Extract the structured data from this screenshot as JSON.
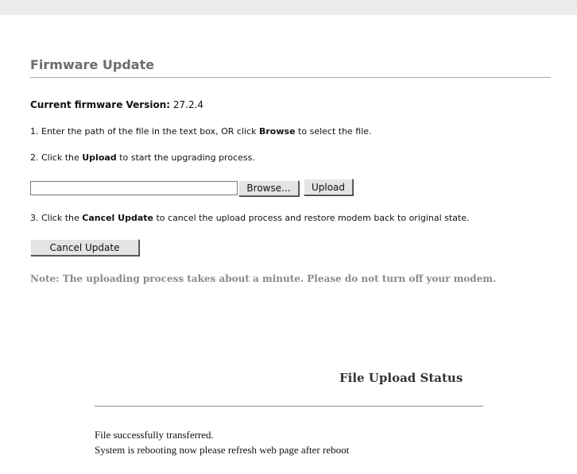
{
  "page": {
    "title": "Firmware Update"
  },
  "version": {
    "label": "Current firmware Version:",
    "value": "27.2.4"
  },
  "steps": {
    "step1": {
      "prefix": "1. Enter the path of the file in the text box, OR click ",
      "emphasis": "Browse",
      "suffix": " to select the file."
    },
    "step2": {
      "prefix": "2. Click the ",
      "emphasis": "Upload",
      "suffix": " to start the upgrading process."
    },
    "step3": {
      "prefix": "3. Click the ",
      "emphasis": "Cancel Update",
      "suffix": " to cancel the upload process and restore modem back to original state."
    }
  },
  "form": {
    "file_value": "",
    "browse_label": "Browse...",
    "upload_label": "Upload",
    "cancel_label": "Cancel Update"
  },
  "note": "Note: The uploading process takes about a minute. Please do not turn off your modem.",
  "status": {
    "title": "File Upload Status",
    "lines": [
      "File successfully transferred.",
      "System is rebooting now please refresh web page after reboot"
    ]
  }
}
